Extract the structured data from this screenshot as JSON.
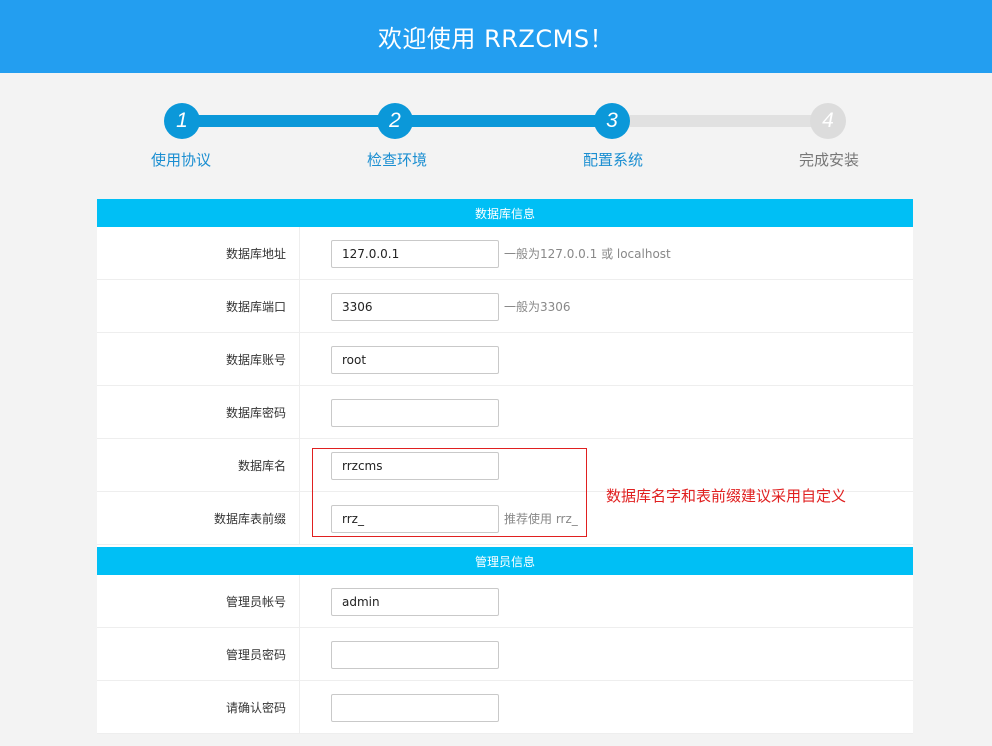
{
  "header": {
    "title": "欢迎使用 RRZCMS！"
  },
  "steps": [
    {
      "number": "1",
      "label": "使用协议",
      "status": "done"
    },
    {
      "number": "2",
      "label": "检查环境",
      "status": "done"
    },
    {
      "number": "3",
      "label": "配置系统",
      "status": "done"
    },
    {
      "number": "4",
      "label": "完成安装",
      "status": "todo"
    }
  ],
  "database": {
    "title": "数据库信息",
    "fields": {
      "host": {
        "label": "数据库地址",
        "value": "127.0.0.1",
        "hint": "一般为127.0.0.1 或 localhost"
      },
      "port": {
        "label": "数据库端口",
        "value": "3306",
        "hint": "一般为3306"
      },
      "user": {
        "label": "数据库账号",
        "value": "root"
      },
      "password": {
        "label": "数据库密码",
        "value": ""
      },
      "name": {
        "label": "数据库名",
        "value": "rrzcms"
      },
      "prefix": {
        "label": "数据库表前缀",
        "value": "rrz_",
        "hint": "推荐使用 rrz_"
      }
    }
  },
  "admin": {
    "title": "管理员信息",
    "fields": {
      "account": {
        "label": "管理员帐号",
        "value": "admin"
      },
      "password": {
        "label": "管理员密码",
        "value": ""
      },
      "confirm": {
        "label": "请确认密码",
        "value": ""
      }
    }
  },
  "annotation": {
    "text": "数据库名字和表前缀建议采用自定义",
    "color": "#e02020"
  },
  "colors": {
    "header": "#239ef0",
    "section": "#00bff5",
    "step_done": "#0b98d9",
    "step_todo": "#dcdcdc"
  }
}
